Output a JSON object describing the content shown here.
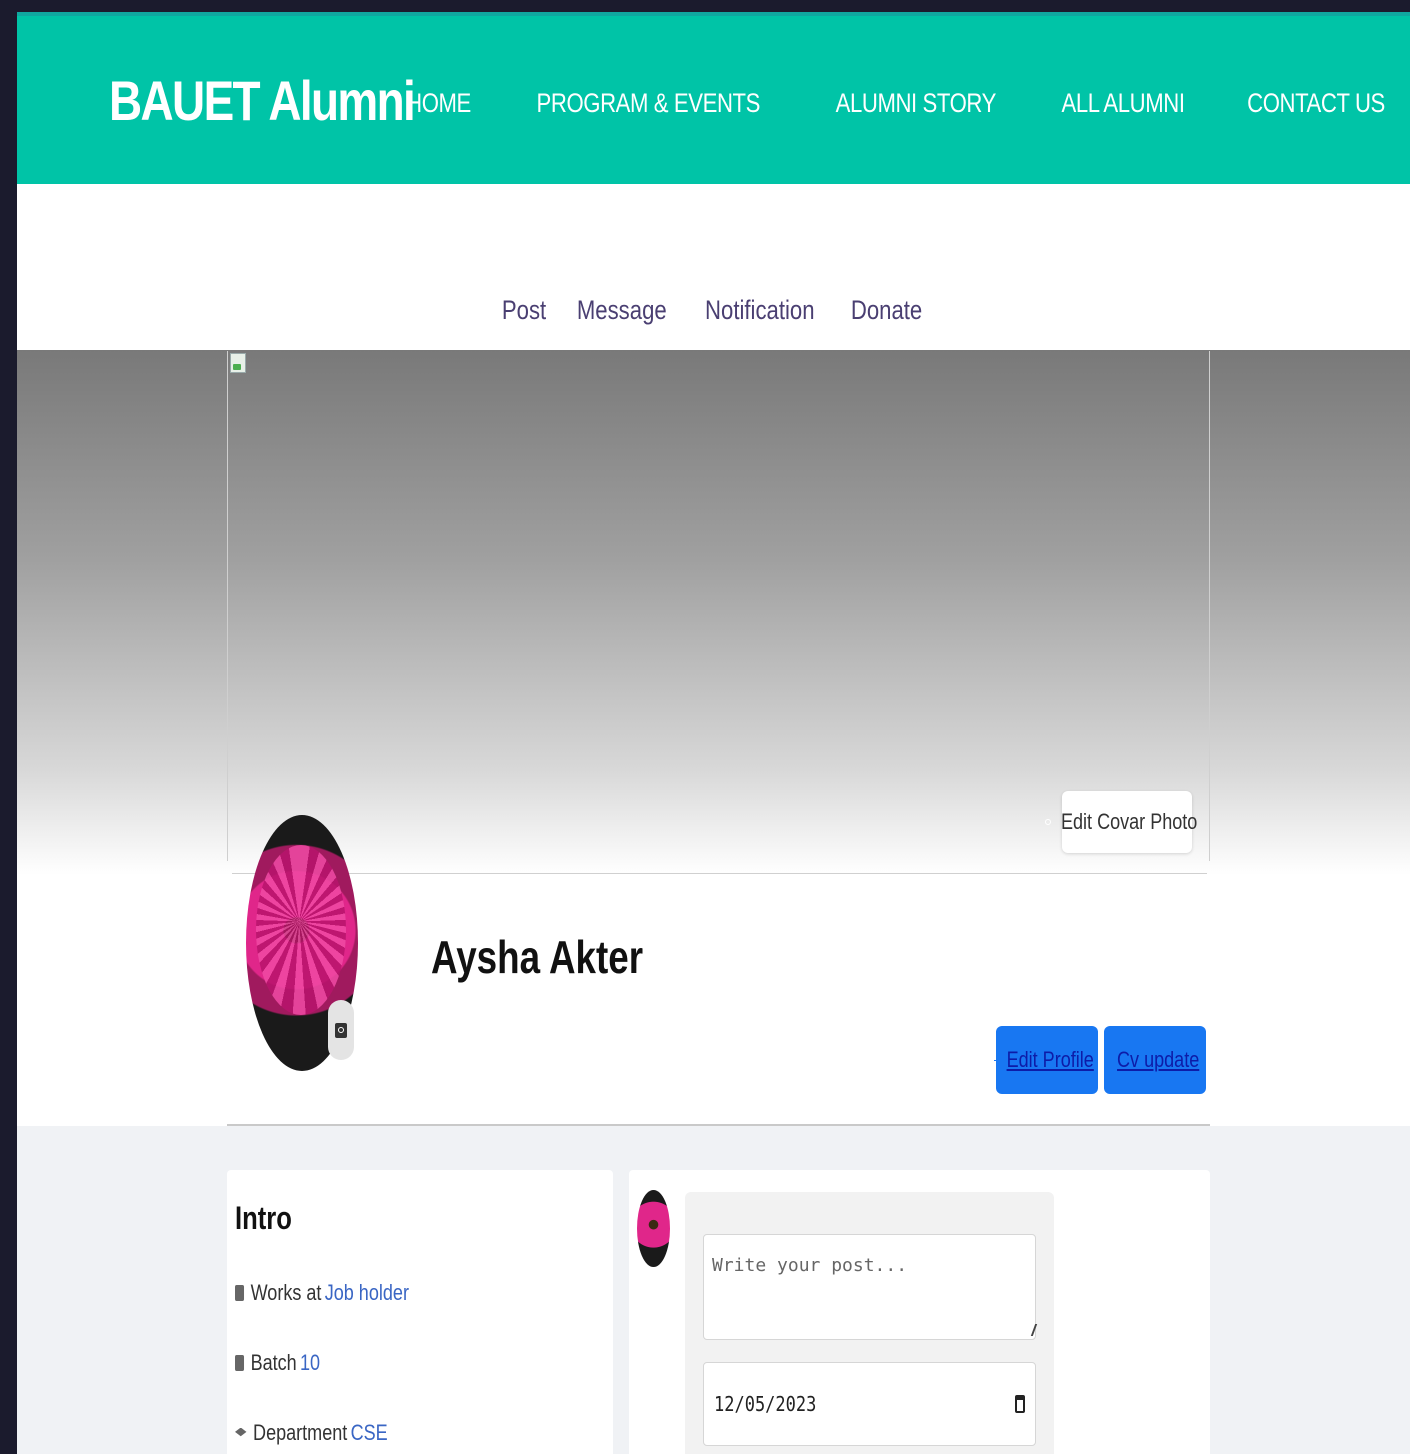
{
  "header": {
    "brand": "BAUET Alumni",
    "nav": [
      "HOME",
      "PROGRAM & EVENTS",
      "ALUMNI STORY",
      "ALL ALUMNI",
      "CONTACT US"
    ]
  },
  "profile_tabs": [
    "Post",
    "Message",
    "Notification",
    "Donate"
  ],
  "cover": {
    "edit_cover_label": "Edit Covar Photo",
    "edit_cover_icon": "camera-icon"
  },
  "profile": {
    "name": "Aysha Akter",
    "edit_profile_label": "Edit Profile",
    "cv_update_label": "Cv update"
  },
  "intro": {
    "title": "Intro",
    "works_label": "Works at",
    "works_value": "Job holder",
    "batch_label": "Batch",
    "batch_value": "10",
    "department_label": "Department",
    "department_value": "CSE"
  },
  "post": {
    "placeholder": "Write your post...",
    "date_value": "12/05/2023"
  },
  "colors": {
    "header": "#00c4a7",
    "button": "#1877f2",
    "link": "#3a66c4"
  }
}
